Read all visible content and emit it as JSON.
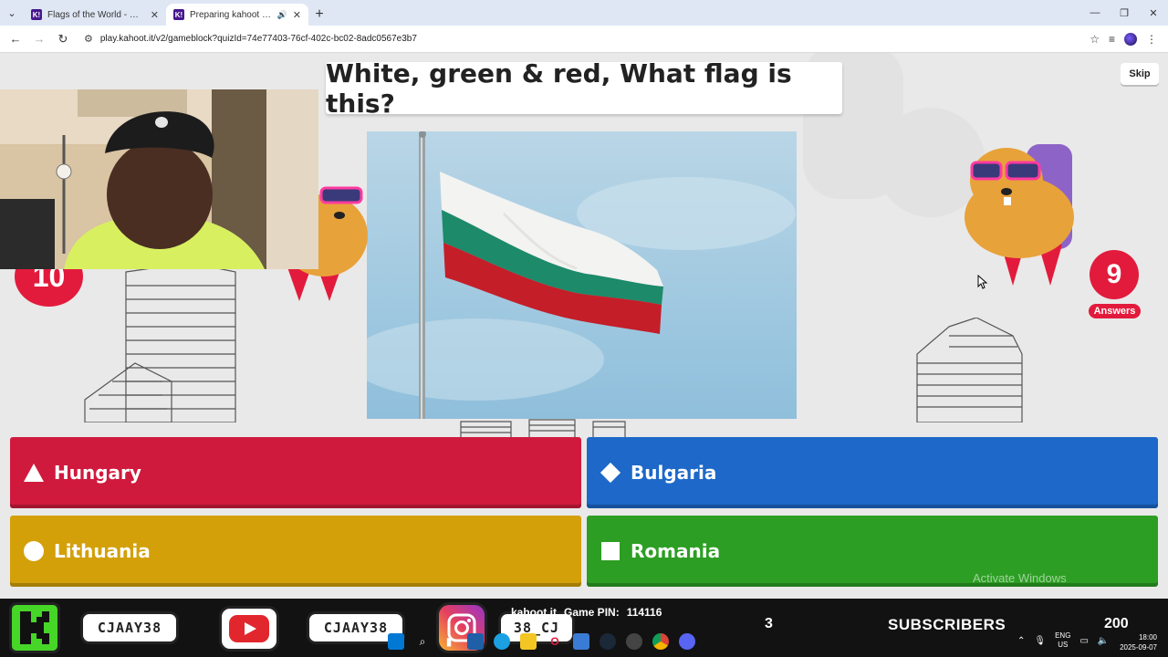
{
  "browser": {
    "tabs": [
      {
        "title": "Flags of the World - Details - K",
        "active": false
      },
      {
        "title": "Preparing kahoot - Kahoot!",
        "active": true
      }
    ],
    "url": "play.kahoot.it/v2/gameblock?quizId=74e77403-76cf-402c-bc02-8adc0567e3b7"
  },
  "game": {
    "question": "White, green & red, What flag is this?",
    "skip_label": "Skip",
    "timer": "10",
    "answers_count": "9",
    "answers_label": "Answers",
    "answers": [
      {
        "label": "Hungary",
        "shape": "triangle",
        "color": "#d01a3d"
      },
      {
        "label": "Bulgaria",
        "shape": "diamond",
        "color": "#1d68c8"
      },
      {
        "label": "Lithuania",
        "shape": "circle",
        "color": "#d3a00a"
      },
      {
        "label": "Romania",
        "shape": "square",
        "color": "#2c9e23"
      }
    ]
  },
  "os": {
    "watermark": "Activate Windows",
    "lang_top": "ENG",
    "lang_bottom": "US",
    "time": "18:00",
    "date": "2025-09-07"
  },
  "overlay": {
    "handle_1": "CJAAY38",
    "handle_2": "CJAAY38",
    "handle_3": "38_CJ",
    "kahoot_brand": "kahoot.it",
    "pin_label": "Game PIN:",
    "pin_value": "114116",
    "subs_count": "3",
    "subs_label": "SUBSCRIBERS",
    "subs_goal": "200"
  },
  "colors": {
    "kahoot_purple": "#46178f",
    "red": "#d01a3d",
    "blue": "#1d68c8",
    "yellow": "#d3a00a",
    "green": "#2c9e23"
  }
}
